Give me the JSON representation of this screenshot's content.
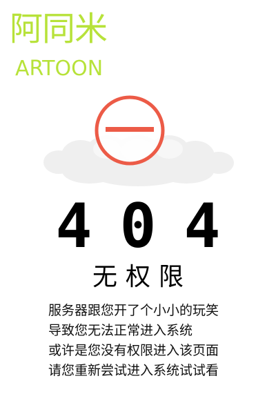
{
  "logo": {
    "cn_text": "阿同米",
    "en_text": "ARTOON",
    "color": "#b7e23a"
  },
  "icon": {
    "name": "no-entry-icon",
    "ring_color": "#ec5b47",
    "cloud_name": "cloud-icon",
    "cloud_color": "#eeeeee"
  },
  "error": {
    "code": "404",
    "title": "无权限"
  },
  "description": {
    "lines": [
      "服务器跟您开了个小小的玩笑",
      "导致您无法正常进入系统",
      "或许是您没有权限进入该页面",
      "请您重新尝试进入系统试试看"
    ]
  }
}
